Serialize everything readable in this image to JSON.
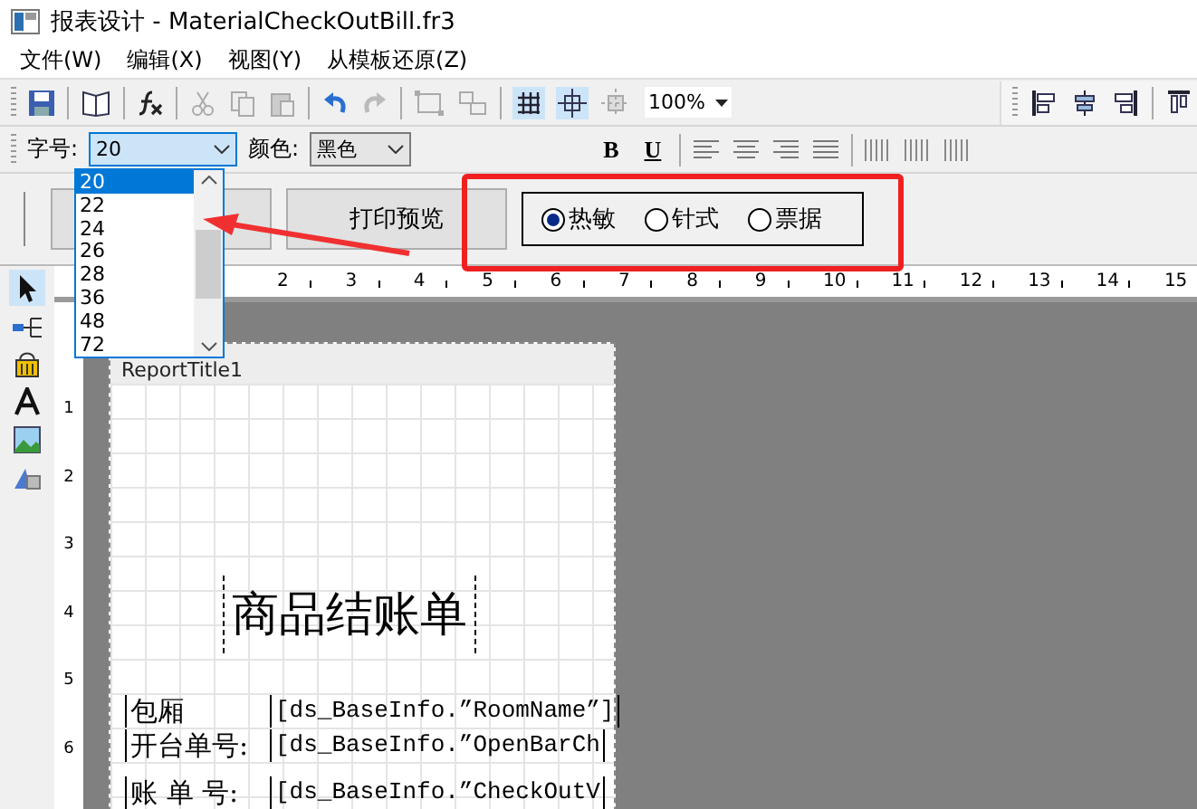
{
  "window": {
    "title": "报表设计 - MaterialCheckOutBill.fr3"
  },
  "menu": [
    {
      "label": "文件(W)"
    },
    {
      "label": "编辑(X)"
    },
    {
      "label": "视图(Y)"
    },
    {
      "label": "从模板还原(Z)"
    }
  ],
  "toolbar": {
    "zoom": "100%"
  },
  "format_bar": {
    "font_size_label": "字号:",
    "font_size": "20",
    "color_label": "颜色:",
    "color_name": "黑色",
    "bold": "B",
    "underline": "U"
  },
  "font_size_list": [
    {
      "label": "20",
      "selected": true
    },
    {
      "label": "22",
      "selected": false
    },
    {
      "label": "24",
      "selected": false
    },
    {
      "label": "26",
      "selected": false
    },
    {
      "label": "28",
      "selected": false
    },
    {
      "label": "36",
      "selected": false
    },
    {
      "label": "48",
      "selected": false
    },
    {
      "label": "72",
      "selected": false
    }
  ],
  "buttons": [
    {
      "label": "打印预览"
    }
  ],
  "print_mode": [
    {
      "label": "热敏",
      "selected": true
    },
    {
      "label": "针式",
      "selected": false
    },
    {
      "label": "票据",
      "selected": false
    }
  ],
  "ruler": {
    "marks": [
      "2",
      "3",
      "4",
      "5",
      "6",
      "7",
      "8",
      "9",
      "10",
      "11",
      "12",
      "13",
      "14",
      "15"
    ],
    "side_marks": [
      "1",
      "2",
      "3",
      "4",
      "5",
      "6"
    ]
  },
  "report": {
    "band": "ReportTitle1",
    "title": "商品结账单",
    "fields": [
      {
        "label": "包厢",
        "value": "[ds_BaseInfo.”RoomName”]"
      },
      {
        "label": "开台单号:",
        "value": "[ds_BaseInfo.”OpenBarCh"
      },
      {
        "label": "账 单 号:",
        "value": "[ds_BaseInfo.”CheckOutV"
      }
    ]
  }
}
